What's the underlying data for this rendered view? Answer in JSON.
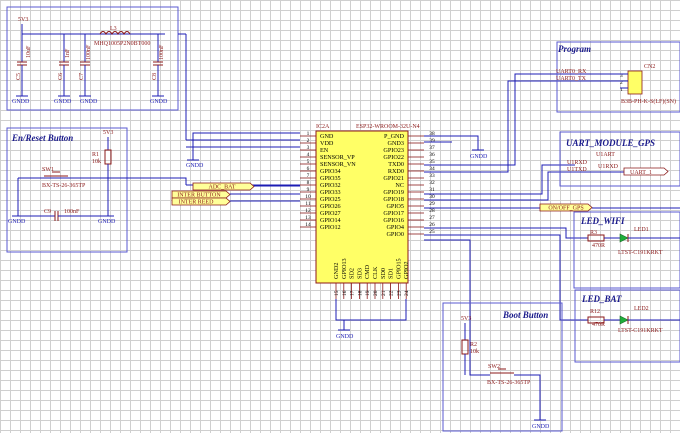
{
  "sections": {
    "en_reset": "En/Reset Button",
    "program": "Program",
    "uart_gps": "UART_MODULE_GPS",
    "led_wifi": "LED_WIFI",
    "led_bat": "LED_BAT",
    "boot": "Boot Button"
  },
  "power": {
    "v_top": "5V3",
    "v_en": "5V3",
    "v_boot": "5V3",
    "gnd": "GNDD"
  },
  "power_filter": {
    "inductor_ref": "L3",
    "inductor_part": "MHQ1005P2N0BT000",
    "caps": [
      {
        "ref": "C5",
        "value": "10uF"
      },
      {
        "ref": "C6",
        "value": "1nF"
      },
      {
        "ref": "C7",
        "value": "100nF"
      },
      {
        "ref": "C8",
        "value": "100nF"
      }
    ]
  },
  "en_reset": {
    "sw_ref": "SW1",
    "sw_part": "BX-TS-26-365TP",
    "r_ref": "R1",
    "r_val": "10k",
    "cap_ref": "C9",
    "cap_val": "100nF"
  },
  "mcu": {
    "ref": "IC2A",
    "part": "ESP32-WROOM-32U-N4",
    "left_pins": [
      {
        "num": "1",
        "name": "GND"
      },
      {
        "num": "2",
        "name": "VDD"
      },
      {
        "num": "3",
        "name": "EN"
      },
      {
        "num": "4",
        "name": "SENSOR_VP"
      },
      {
        "num": "5",
        "name": "SENSOR_VN"
      },
      {
        "num": "6",
        "name": "GPIO34"
      },
      {
        "num": "7",
        "name": "GPIO35"
      },
      {
        "num": "8",
        "name": "GPIO32"
      },
      {
        "num": "9",
        "name": "GPIO33"
      },
      {
        "num": "10",
        "name": "GPIO25"
      },
      {
        "num": "11",
        "name": "GPIO26"
      },
      {
        "num": "12",
        "name": "GPIO27"
      },
      {
        "num": "13",
        "name": "GPIO14"
      },
      {
        "num": "14",
        "name": "GPIO12"
      }
    ],
    "right_pins": [
      {
        "num": "38",
        "name": "P_GND"
      },
      {
        "num": "39",
        "name": "GND3"
      },
      {
        "num": "37",
        "name": "GPIO23"
      },
      {
        "num": "36",
        "name": "GPIO22"
      },
      {
        "num": "35",
        "name": "TXD0"
      },
      {
        "num": "34",
        "name": "RXD0"
      },
      {
        "num": "33",
        "name": "GPIO21"
      },
      {
        "num": "32",
        "name": "NC"
      },
      {
        "num": "31",
        "name": "GPIO19"
      },
      {
        "num": "30",
        "name": "GPIO18"
      },
      {
        "num": "29",
        "name": "GPIO5"
      },
      {
        "num": "28",
        "name": "GPIO17"
      },
      {
        "num": "27",
        "name": "GPIO16"
      },
      {
        "num": "26",
        "name": "GPIO4"
      },
      {
        "num": "25",
        "name": "GPIO0"
      }
    ],
    "bottom_pins": [
      {
        "num": "15",
        "name": "GND2"
      },
      {
        "num": "16",
        "name": "GPIO13"
      },
      {
        "num": "17",
        "name": "SD2"
      },
      {
        "num": "18",
        "name": "SD3"
      },
      {
        "num": "19",
        "name": "CMD"
      },
      {
        "num": "20",
        "name": "CLK"
      },
      {
        "num": "21",
        "name": "SD0"
      },
      {
        "num": "22",
        "name": "SD1"
      },
      {
        "num": "23",
        "name": "GPIO15"
      },
      {
        "num": "24",
        "name": "GPIO2"
      }
    ]
  },
  "nets": {
    "adc_bat": "ADC_BAT",
    "inter_button": "INTER BUTTON",
    "inter_reed": "INTER REED",
    "on_off_gps": "ON/OFF_GPS",
    "uart0_rx": "UART0_RX",
    "uart0_tx": "UART0_TX",
    "u_rxd": "U1RXD",
    "u_txd": "U1TXD"
  },
  "program": {
    "cn_ref": "CN2",
    "cn_part": "B3B-PH-K-S(LF)(SN)",
    "pins": [
      "3",
      "2",
      "1"
    ]
  },
  "uart_gps": {
    "ref": "U1ART",
    "rx": "U1RXD",
    "tx": "UART_1"
  },
  "led_wifi": {
    "r_ref": "R3",
    "r_val": "470R",
    "led_ref": "LED1",
    "led_part": "LTST-C191KRKT"
  },
  "led_bat": {
    "r_ref": "R12",
    "r_val": "470R",
    "led_ref": "LED2",
    "led_part": "LTST-C191KRKT"
  },
  "boot": {
    "r_ref": "R2",
    "r_val": "10k",
    "sw_ref": "SW2",
    "sw_part": "BX-TS-26-365TP"
  }
}
